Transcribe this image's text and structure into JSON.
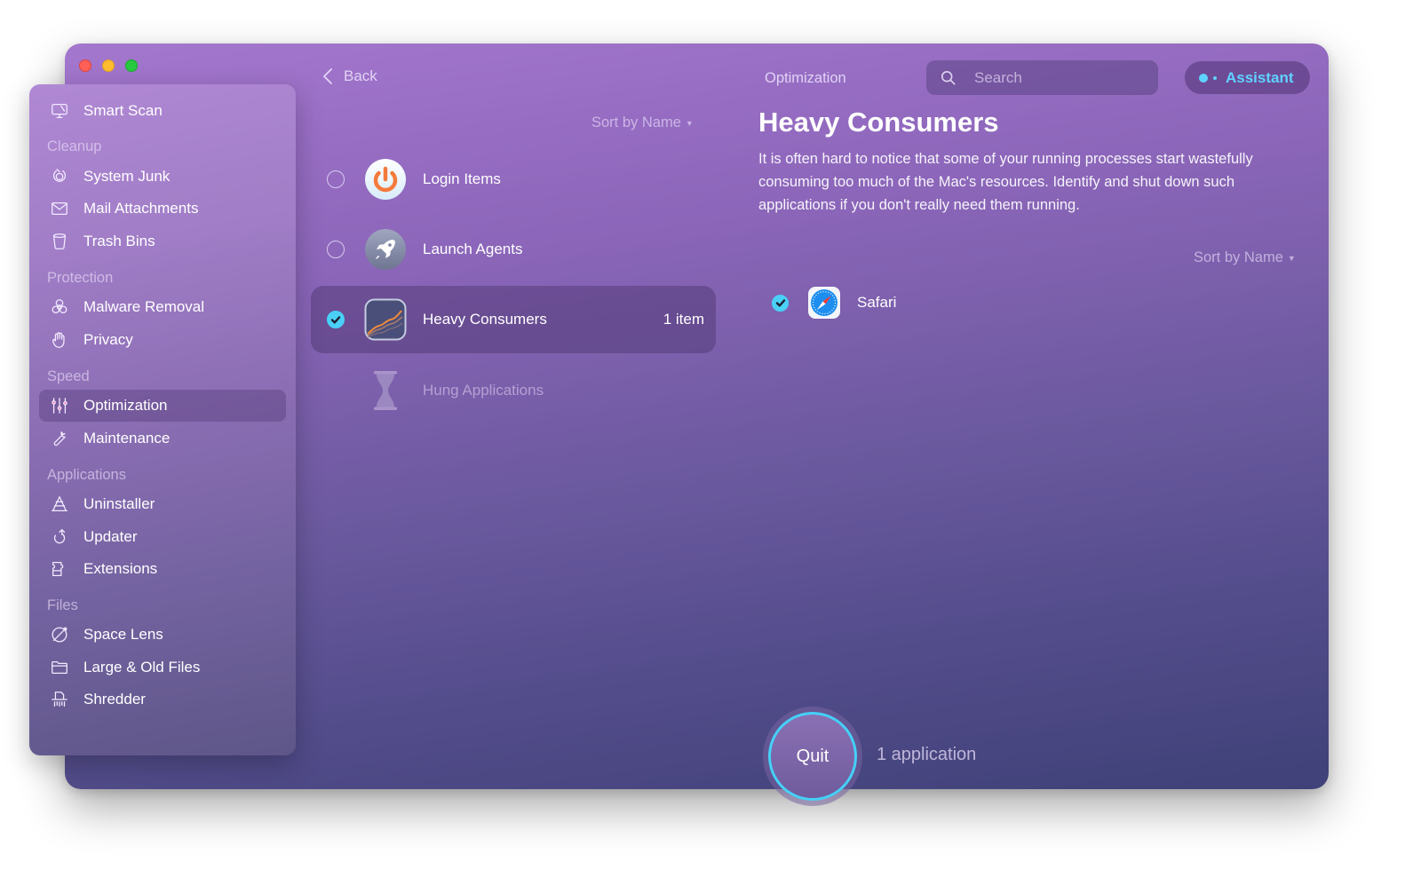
{
  "window": {
    "traffic_lights": [
      "close",
      "minimize",
      "zoom"
    ]
  },
  "sidebar": {
    "top_item": {
      "label": "Smart Scan",
      "icon": "monitor-icon"
    },
    "sections": [
      {
        "title": "Cleanup",
        "items": [
          {
            "label": "System Junk",
            "icon": "system-junk-icon"
          },
          {
            "label": "Mail Attachments",
            "icon": "mail-icon"
          },
          {
            "label": "Trash Bins",
            "icon": "trash-icon"
          }
        ]
      },
      {
        "title": "Protection",
        "items": [
          {
            "label": "Malware Removal",
            "icon": "biohazard-icon"
          },
          {
            "label": "Privacy",
            "icon": "hand-icon"
          }
        ]
      },
      {
        "title": "Speed",
        "items": [
          {
            "label": "Optimization",
            "icon": "sliders-icon",
            "active": true
          },
          {
            "label": "Maintenance",
            "icon": "wrench-icon"
          }
        ]
      },
      {
        "title": "Applications",
        "items": [
          {
            "label": "Uninstaller",
            "icon": "uninstaller-icon"
          },
          {
            "label": "Updater",
            "icon": "update-arrow-icon"
          },
          {
            "label": "Extensions",
            "icon": "puzzle-icon"
          }
        ]
      },
      {
        "title": "Files",
        "items": [
          {
            "label": "Space Lens",
            "icon": "planet-icon"
          },
          {
            "label": "Large & Old Files",
            "icon": "folder-icon"
          },
          {
            "label": "Shredder",
            "icon": "shredder-icon"
          }
        ]
      }
    ]
  },
  "header": {
    "back_label": "Back",
    "title": "Optimization",
    "search_placeholder": "Search",
    "assistant_label": "Assistant"
  },
  "list": {
    "sort_label": "Sort by Name",
    "items": [
      {
        "label": "Login Items",
        "icon": "power-icon",
        "checked": false,
        "count": ""
      },
      {
        "label": "Launch Agents",
        "icon": "rocket-icon",
        "checked": false,
        "count": ""
      },
      {
        "label": "Heavy Consumers",
        "icon": "chart-icon",
        "checked": true,
        "selected": true,
        "count": "1 item"
      },
      {
        "label": "Hung Applications",
        "icon": "hourglass-icon",
        "checked": false,
        "disabled": true,
        "count": ""
      }
    ]
  },
  "detail": {
    "title": "Heavy Consumers",
    "description": "It is often hard to notice that some of your running processes start wastefully consuming too much of the Mac's resources. Identify and shut down such applications if you don't really need them running.",
    "sort_label": "Sort by Name",
    "apps": [
      {
        "name": "Safari",
        "icon": "safari-icon",
        "checked": true
      }
    ]
  },
  "footer": {
    "quit_label": "Quit",
    "summary": "1 application"
  },
  "colors": {
    "accent": "#4ad0f7",
    "assistant": "#5fd3ff",
    "window_top": "#a377cd",
    "window_bottom": "#3f4178"
  }
}
